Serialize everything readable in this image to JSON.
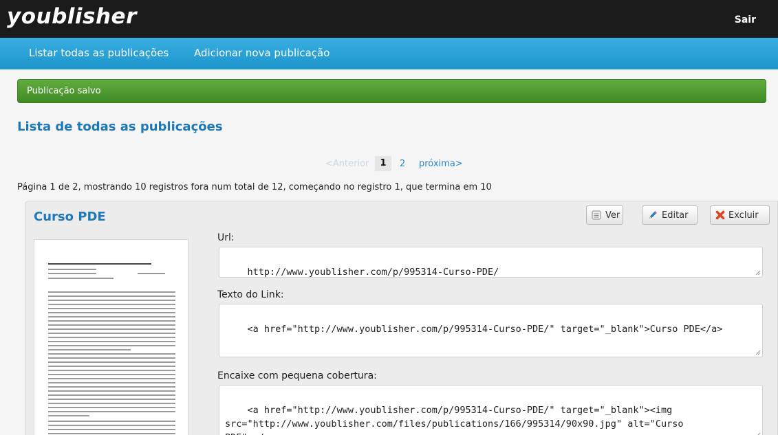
{
  "header": {
    "logo": "youblisher",
    "logout_label": "Sair"
  },
  "nav": {
    "list_all": "Listar todas as publicações",
    "add_new": "Adicionar nova publicação"
  },
  "flash": {
    "message": "Publicação salvo",
    "color": "#4c9b30"
  },
  "page": {
    "title": "Lista de todas as publicações"
  },
  "pagination": {
    "prev": "<Anterior",
    "current": "1",
    "page2": "2",
    "next": "próxima>",
    "summary": "Página 1 de 2, mostrando 10 registros fora num total de 12, começando no registro 1, que termina em 10"
  },
  "publication": {
    "title": "Curso PDE",
    "buttons": {
      "view": "Ver",
      "edit": "Editar",
      "delete": "Excluir"
    },
    "icons": {
      "view": "document-icon",
      "edit": "pencil-icon",
      "delete": "x-icon"
    },
    "fields": {
      "url_label": "Url:",
      "url_value": "http://www.youblisher.com/p/995314-Curso-PDE/",
      "link_label": "Texto do Link:",
      "link_value": "<a href=\"http://www.youblisher.com/p/995314-Curso-PDE/\" target=\"_blank\">Curso PDE</a>",
      "embed_label": "Encaixe com pequena cobertura:",
      "embed_value": "<a href=\"http://www.youblisher.com/p/995314-Curso-PDE/\" target=\"_blank\"><img\nsrc=\"http://www.youblisher.com/files/publications/166/995314/90x90.jpg\" alt=\"Curso\nPDE\"></a>"
    }
  },
  "colors": {
    "accent": "#1f79b6",
    "navbar": "#28a1d8",
    "topbar": "#1b1b1b"
  }
}
